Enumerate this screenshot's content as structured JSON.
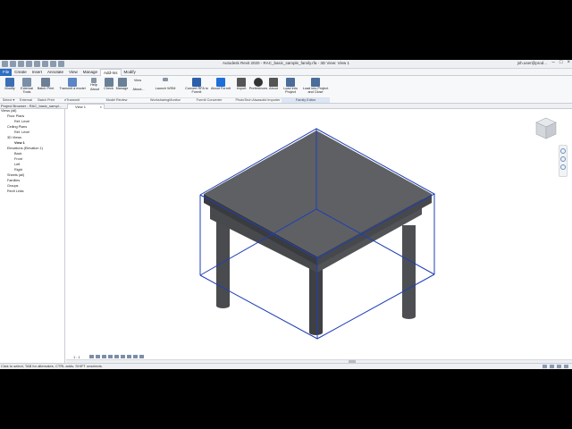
{
  "window": {
    "title": "Autodesk Revit 2020 - RAC_basic_sample_family.rfa - 3D View: View 1",
    "user": "jsh.user@prod..."
  },
  "tabs": [
    "File",
    "Create",
    "Insert",
    "Annotate",
    "View",
    "Manage",
    "Add-Ins",
    "Modify"
  ],
  "active_tab": "Add-Ins",
  "ribbon": {
    "buttons": [
      {
        "label": "Modify",
        "icon": "cursor-icon",
        "color": "#3a6fb5"
      },
      {
        "label": "External Tools",
        "icon": "external-tools-icon",
        "color": "#7a8fa8"
      },
      {
        "label": "Batch Print",
        "icon": "printer-icon",
        "color": "#6b7f96"
      },
      {
        "label": "Transmit a model",
        "icon": "transmit-icon",
        "color": "#5c86c4"
      },
      {
        "label": "Help",
        "icon": "help-icon",
        "color": "#8895a6"
      },
      {
        "label": "About",
        "icon": "about-icon",
        "color": "#8895a6"
      },
      {
        "label": "Check",
        "icon": "check-icon",
        "color": "#6a7f98"
      },
      {
        "label": "Manage",
        "icon": "manage-icon",
        "color": "#6a7f98"
      },
      {
        "label": "View",
        "icon": "view-icon",
        "color": "#8895a6"
      },
      {
        "label": "About...",
        "icon": "about-icon",
        "color": "#8895a6"
      },
      {
        "label": "Launch WSM",
        "icon": "launch-wsm-icon",
        "color": "#8895a6"
      },
      {
        "label": "Convert RFA to FormIt",
        "icon": "convert-icon",
        "color": "#2d5fa8"
      },
      {
        "label": "About FormIt",
        "icon": "formit-icon",
        "color": "#1e6fd9"
      },
      {
        "label": "Import",
        "icon": "import-icon",
        "color": "#555555"
      },
      {
        "label": "Preferences",
        "icon": "preferences-icon",
        "color": "#333333"
      },
      {
        "label": "About",
        "icon": "about-icon",
        "color": "#555555"
      },
      {
        "label": "Load into Project",
        "icon": "load-project-icon",
        "color": "#4a6d99"
      },
      {
        "label": "Load into Project and Close",
        "icon": "load-close-icon",
        "color": "#4a6d99"
      }
    ],
    "panels": [
      {
        "label": "Select ▾",
        "highlight": false
      },
      {
        "label": "External",
        "highlight": false
      },
      {
        "label": "Batch Print",
        "highlight": false
      },
      {
        "label": "eTransmit",
        "highlight": false
      },
      {
        "label": "Model Review",
        "highlight": false
      },
      {
        "label": "WorksharingMonitor",
        "highlight": false
      },
      {
        "label": "FormIt Converter",
        "highlight": false
      },
      {
        "label": "PhotoTech Alwasolid Importer",
        "highlight": false
      },
      {
        "label": "Family Editor",
        "highlight": true
      }
    ]
  },
  "project_browser": {
    "title": "Project Browser - RAC_basic_sampl...",
    "items": [
      {
        "label": "Views (all)",
        "bold": false
      },
      {
        "label": "Floor Plans",
        "bold": false
      },
      {
        "label": "Ref. Level",
        "bold": false
      },
      {
        "label": "Ceiling Plans",
        "bold": false
      },
      {
        "label": "Ref. Level",
        "bold": false
      },
      {
        "label": "3D Views",
        "bold": false
      },
      {
        "label": "View 1",
        "bold": true
      },
      {
        "label": "Elevations (Elevation 1)",
        "bold": false
      },
      {
        "label": "Back",
        "bold": false
      },
      {
        "label": "Front",
        "bold": false
      },
      {
        "label": "Left",
        "bold": false
      },
      {
        "label": "Right",
        "bold": false
      },
      {
        "label": "Sheets (all)",
        "bold": false
      },
      {
        "label": "Families",
        "bold": false
      },
      {
        "label": "Groups",
        "bold": false
      },
      {
        "label": "Revit Links",
        "bold": false
      }
    ]
  },
  "view_tab": {
    "label": "View 1",
    "close": "×"
  },
  "view_control": {
    "scale": "1 : 1"
  },
  "status": {
    "text": "Click to select, TAB for alternates, CTRL adds, SHIFT unselects."
  },
  "colors": {
    "file_tab": "#2e6dc2",
    "selection_box": "#1f3fb5",
    "table_top": "#5f6063"
  }
}
